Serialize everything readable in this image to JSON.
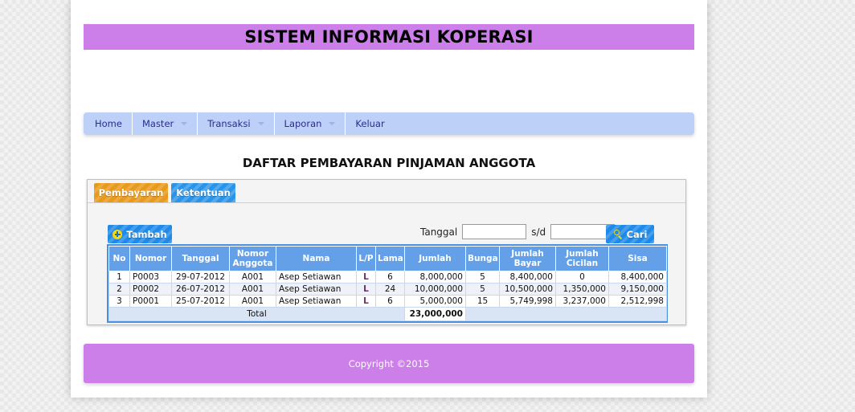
{
  "banner": {
    "title": "SISTEM INFORMASI KOPERASI"
  },
  "nav": {
    "items": [
      {
        "label": "Home",
        "has_caret": false
      },
      {
        "label": "Master",
        "has_caret": true
      },
      {
        "label": "Transaksi",
        "has_caret": true
      },
      {
        "label": "Laporan",
        "has_caret": true
      },
      {
        "label": "Keluar",
        "has_caret": false
      }
    ]
  },
  "page": {
    "heading": "DAFTAR PEMBAYARAN PINJAMAN ANGGOTA"
  },
  "tabs": [
    {
      "label": "Pembayaran",
      "active": true
    },
    {
      "label": "Ketentuan",
      "active": false
    }
  ],
  "toolbar": {
    "add_label": "Tambah",
    "add_icon": "plus-circle-icon",
    "search_label": "Cari",
    "search_icon": "magnifier-icon",
    "date_label": "Tanggal",
    "date_separator": "s/d",
    "date_from_value": "",
    "date_to_value": "",
    "date_from_placeholder": "",
    "date_to_placeholder": ""
  },
  "table": {
    "headers": [
      "No",
      "Nomor",
      "Tanggal",
      "Nomor Anggota",
      "Nama",
      "L/P",
      "Lama",
      "Jumlah",
      "Bunga",
      "Jumlah Bayar",
      "Jumlah Cicilan",
      "Sisa"
    ],
    "headers_multiline": {
      "nomor_anggota": [
        "Nomor",
        "Anggota"
      ],
      "jumlah_bayar": [
        "Jumlah",
        "Bayar"
      ],
      "jumlah_cicilan": [
        "Jumlah",
        "Cicilan"
      ]
    },
    "rows": [
      {
        "no": "1",
        "nomor": "P0003",
        "tanggal": "29-07-2012",
        "nomor_anggota": "A001",
        "nama": "Asep Setiawan",
        "lp": "L",
        "lama": "6",
        "jumlah": "8,000,000",
        "bunga": "5",
        "jumlah_bayar": "8,400,000",
        "jumlah_cicilan": "0",
        "sisa": "8,400,000"
      },
      {
        "no": "2",
        "nomor": "P0002",
        "tanggal": "26-07-2012",
        "nomor_anggota": "A001",
        "nama": "Asep Setiawan",
        "lp": "L",
        "lama": "24",
        "jumlah": "10,000,000",
        "bunga": "5",
        "jumlah_bayar": "10,500,000",
        "jumlah_cicilan": "1,350,000",
        "sisa": "9,150,000"
      },
      {
        "no": "3",
        "nomor": "P0001",
        "tanggal": "25-07-2012",
        "nomor_anggota": "A001",
        "nama": "Asep Setiawan",
        "lp": "L",
        "lama": "6",
        "jumlah": "5,000,000",
        "bunga": "15",
        "jumlah_bayar": "5,749,998",
        "jumlah_cicilan": "3,237,000",
        "sisa": "2,512,998"
      }
    ],
    "footer": {
      "label": "Total",
      "value": "23,000,000"
    }
  },
  "footer": {
    "text": "Copyright ©2015"
  },
  "colors": {
    "banner": "#cc7fe8",
    "nav": "#bdd0f7",
    "tab_active": "#e89a1c",
    "tab_inactive": "#2a94e8",
    "button": "#1f8ae8",
    "table_header": "#63a0e8",
    "table_border": "#4a90e2",
    "footer": "#cc7fe8"
  }
}
